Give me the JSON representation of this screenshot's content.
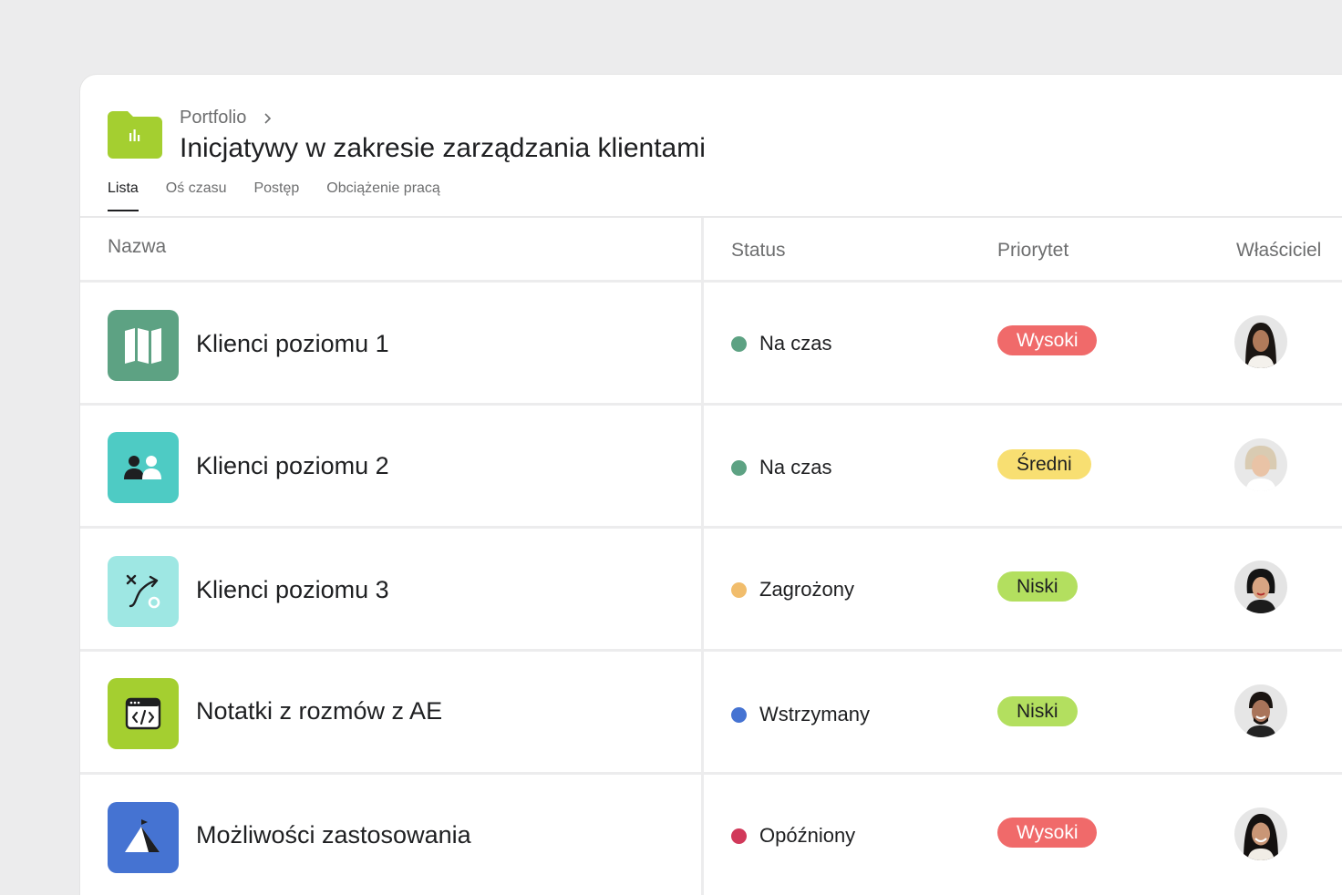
{
  "header": {
    "breadcrumb": "Portfolio",
    "title": "Inicjatywy w zakresie zarządzania klientami",
    "tabs": [
      {
        "label": "Lista",
        "active": true
      },
      {
        "label": "Oś czasu",
        "active": false
      },
      {
        "label": "Postęp",
        "active": false
      },
      {
        "label": "Obciążenie pracą",
        "active": false
      }
    ],
    "folder_icon": "folder-chart-icon",
    "folder_color": "#a4cf30"
  },
  "columns": {
    "name": "Nazwa",
    "status": "Status",
    "priority": "Priorytet",
    "owner": "Właściciel"
  },
  "rows": [
    {
      "name": "Klienci poziomu 1",
      "icon": "map-icon",
      "icon_color": "#5da283",
      "status": "Na czas",
      "status_color": "#5da283",
      "priority": "Wysoki",
      "priority_bg": "#f06a6a",
      "priority_fg": "#ffffff"
    },
    {
      "name": "Klienci poziomu 2",
      "icon": "people-icon",
      "icon_color": "#4ecbc4",
      "status": "Na czas",
      "status_color": "#5da283",
      "priority": "Średni",
      "priority_bg": "#f8df72",
      "priority_fg": "#1e1f21"
    },
    {
      "name": "Klienci poziomu 3",
      "icon": "strategy-icon",
      "icon_color": "#9ee7e3",
      "status": "Zagrożony",
      "status_color": "#f1bd6c",
      "priority": "Niski",
      "priority_bg": "#b3df5f",
      "priority_fg": "#1e1f21"
    },
    {
      "name": "Notatki z rozmów z AE",
      "icon": "code-window-icon",
      "icon_color": "#a4cf30",
      "status": "Wstrzymany",
      "status_color": "#4573d2",
      "priority": "Niski",
      "priority_bg": "#b3df5f",
      "priority_fg": "#1e1f21"
    },
    {
      "name": "Możliwości zastosowania",
      "icon": "mountain-flag-icon",
      "icon_color": "#4573d2",
      "status": "Opóźniony",
      "status_color": "#d1395a",
      "priority": "Wysoki",
      "priority_bg": "#f06a6a",
      "priority_fg": "#ffffff"
    }
  ]
}
